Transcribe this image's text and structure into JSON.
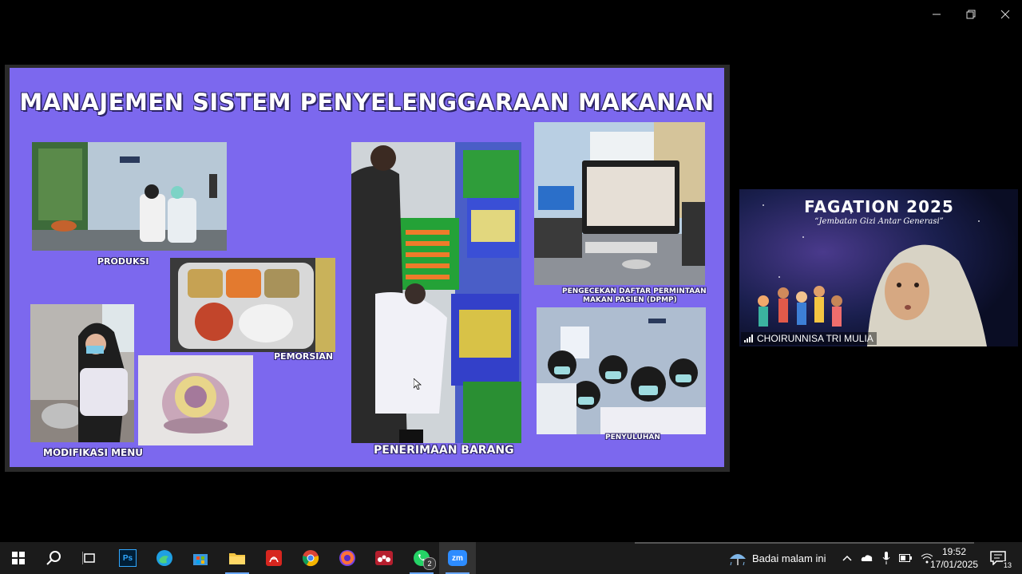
{
  "window": {
    "controls": [
      "minimize",
      "restore",
      "close"
    ]
  },
  "slide": {
    "title": "MANAJEMEN SISTEM PENYELENGGARAAN MAKANAN",
    "background_color": "#7c68ee",
    "captions": {
      "produksi": "PRODUKSI",
      "pemorsian": "PEMORSIAN",
      "modifikasi": "MODIFIKASI MENU",
      "penerimaan": "PENERIMAAN BARANG",
      "pengecekan_line1": "PENGECEKAN DAFTAR PERMINTAAN",
      "pengecekan_line2": "MAKAN PASIEN (DPMP)",
      "penyuluhan": "PENYULUHAN"
    }
  },
  "participant": {
    "banner_title": "FAGATION 2025",
    "banner_subtitle": "“Jembatan Gizi Antar Generasi”",
    "name": "CHOIRUNNISA TRI MULIA"
  },
  "taskbar": {
    "apps": [
      "windows-start",
      "search",
      "task-view",
      "photoshop",
      "edge",
      "microsoft-store",
      "file-explorer",
      "acrobat-reader",
      "chrome",
      "firefox",
      "mendeley",
      "whatsapp",
      "zoom"
    ],
    "whatsapp_badge": "2",
    "weather_text": "Badai malam ini",
    "time": "19:52",
    "date": "17/01/2025",
    "notifications": "13"
  }
}
